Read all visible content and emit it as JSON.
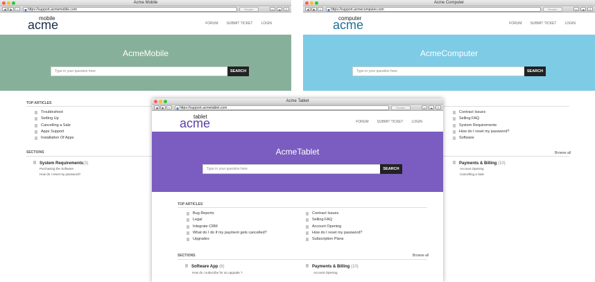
{
  "colors": {
    "mobile_hero": "#87b09a",
    "computer_hero": "#7ecbe6",
    "tablet_hero": "#7b5cc0"
  },
  "mobile": {
    "window_title": "Acme Mobile",
    "url": "https://support.acmemobile.com",
    "reader": "Reader",
    "logo_sub": "mobile",
    "logo_main": "acme",
    "nav": [
      "FORUM",
      "SUBMIT TICKET",
      "LOGIN"
    ],
    "hero_title": "AcmeMobile",
    "search_placeholder": "Type in your question here",
    "search_button": "SEARCH",
    "top_articles_label": "TOP ARTICLES",
    "articles": [
      "Troubleshoot",
      "Setting Up",
      "Cancelling a Sale",
      "Apps Support",
      "Installation Of Apps"
    ],
    "sections_label": "SECTIONS",
    "section_title": "System Requirements",
    "section_count": "(3)",
    "section_items": [
      "Purchasing the Software",
      "How do I reset my password?"
    ]
  },
  "computer": {
    "window_title": "Acme Computer",
    "url": "https://support.acmecomputer.com",
    "reader": "Reader",
    "logo_sub": "computer",
    "logo_main": "acme",
    "nav": [
      "FORUM",
      "SUBMIT TICKET",
      "LOGIN"
    ],
    "hero_title": "AcmeComputer",
    "search_placeholder": "Type in your question here",
    "search_button": "SEARCH",
    "articles": [
      "Contract Issues",
      "Selling FAQ",
      "System Requirements",
      "How do I reset my password?",
      "Software"
    ],
    "browse_all": "Browse all",
    "section_title": "Payments & Billing",
    "section_count": "(10)",
    "section_items": [
      "Account Opening",
      "Cancelling a Sale"
    ]
  },
  "tablet": {
    "window_title": "Acme Tablet",
    "url": "https://support.acmetablet.com",
    "reader": "Reader",
    "logo_sub": "tablet",
    "logo_main": "acme",
    "nav": [
      "FORUM",
      "SUBMIT TICKET",
      "LOGIN"
    ],
    "hero_title": "AcmeTablet",
    "search_placeholder": "Type in your question here",
    "search_button": "SEARCH",
    "top_articles_label": "TOP ARTICLES",
    "articles_left": [
      "Bug Reports",
      "Legal",
      "Integrate CRM",
      "What do I do if my payment gets cancelled?",
      "Upgrades"
    ],
    "articles_right": [
      "Contract Issues",
      "Selling FAQ",
      "Account Opening",
      "How do I reset my password?",
      "Subscription Plans"
    ],
    "sections_label": "SECTIONS",
    "browse_all": "Browse all",
    "section1_title": "Software App",
    "section1_count": "(6)",
    "section1_item": "How do I subscribe for an upgrade ?",
    "section2_title": "Payments & Billing",
    "section2_count": "(10)",
    "section2_item": "Account Opening"
  }
}
